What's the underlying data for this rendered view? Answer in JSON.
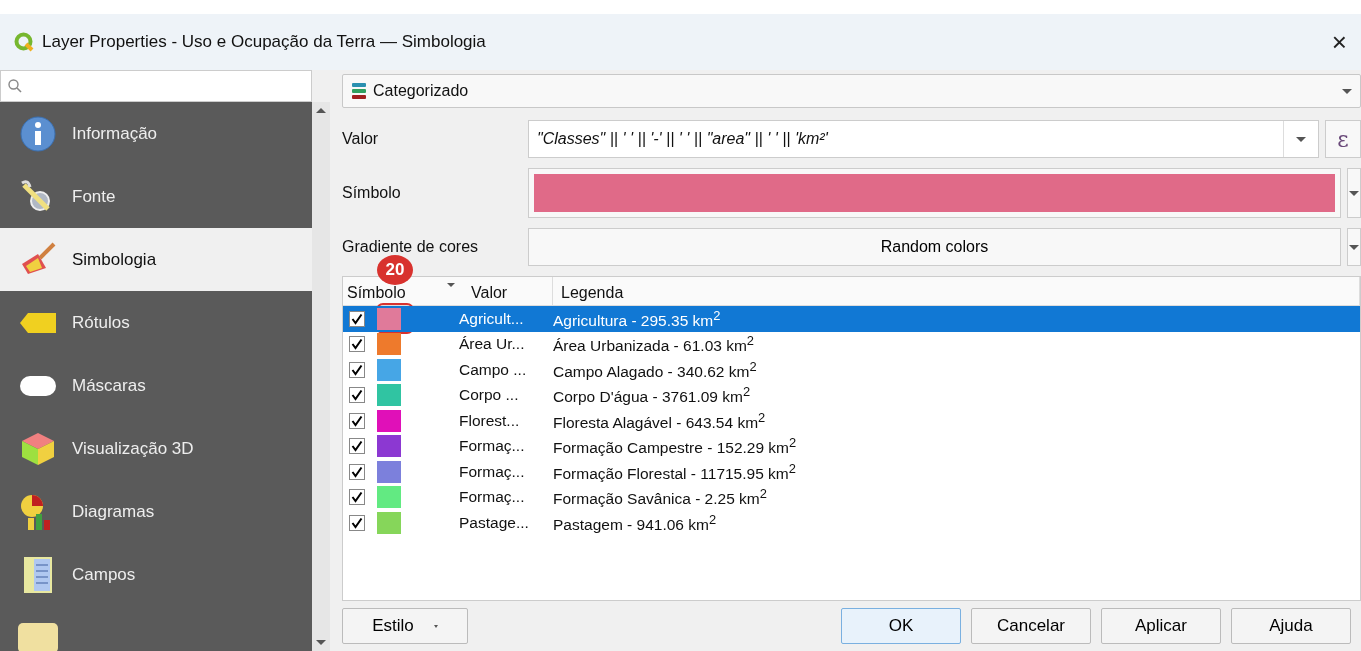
{
  "window": {
    "title": "Layer Properties - Uso e Ocupação da Terra — Simbologia",
    "close": "×"
  },
  "sidebar": {
    "items": [
      {
        "label": "Informação",
        "selected": false
      },
      {
        "label": "Fonte",
        "selected": false
      },
      {
        "label": "Simbologia",
        "selected": true
      },
      {
        "label": "Rótulos",
        "selected": false
      },
      {
        "label": "Máscaras",
        "selected": false
      },
      {
        "label": "Visualização 3D",
        "selected": false
      },
      {
        "label": "Diagramas",
        "selected": false
      },
      {
        "label": "Campos",
        "selected": false
      },
      {
        "selected": false
      }
    ]
  },
  "renderer": "Categorizado",
  "valor": {
    "label": "Valor",
    "expression": "\"Classes\" || ' ' || '-' || ' ' || \"area\" || ' ' || 'km²'",
    "epsilon": "ε"
  },
  "simbolo": {
    "label": "Símbolo",
    "color": "#e06a88"
  },
  "gradiente": {
    "label": "Gradiente de cores",
    "value": "Random colors"
  },
  "table": {
    "columns": [
      "Símbolo",
      "Valor",
      "Legenda"
    ],
    "annotation": "20",
    "rows": [
      {
        "checked": true,
        "color": "#e07a9a",
        "value": "Agricult...",
        "legend": "Agricultura - 295.35 km$^{2}$",
        "selected": true
      },
      {
        "checked": true,
        "color": "#ee7a2c",
        "value": "Área Ur...",
        "legend": "Área Urbanizada - 61.03 km$^{2}$",
        "selected": false
      },
      {
        "checked": true,
        "color": "#46a6e6",
        "value": "Campo ...",
        "legend": "Campo Alagado - 340.62 km$^{2}$",
        "selected": false
      },
      {
        "checked": true,
        "color": "#30c4a2",
        "value": "Corpo ...",
        "legend": "Corpo D'água - 3761.09 km$^{2}$",
        "selected": false
      },
      {
        "checked": true,
        "color": "#e010b8",
        "value": "Florest...",
        "legend": "Floresta Alagável - 643.54 km$^{2}$",
        "selected": false
      },
      {
        "checked": true,
        "color": "#8c38d2",
        "value": "Formaç...",
        "legend": "Formação Campestre - 152.29 km$^{2}$",
        "selected": false
      },
      {
        "checked": true,
        "color": "#7c80dc",
        "value": "Formaç...",
        "legend": "Formação Florestal - 11715.95 km$^{2}$",
        "selected": false
      },
      {
        "checked": true,
        "color": "#62ea82",
        "value": "Formaç...",
        "legend": "Formação Savânica - 2.25 km$^{2}$",
        "selected": false
      },
      {
        "checked": true,
        "color": "#86d65a",
        "value": "Pastage...",
        "legend": "Pastagem - 941.06 km$^{2}$",
        "selected": false
      }
    ]
  },
  "buttons": {
    "style": "Estilo",
    "actions": [
      "OK",
      "Cancelar",
      "Aplicar",
      "Ajuda"
    ]
  }
}
